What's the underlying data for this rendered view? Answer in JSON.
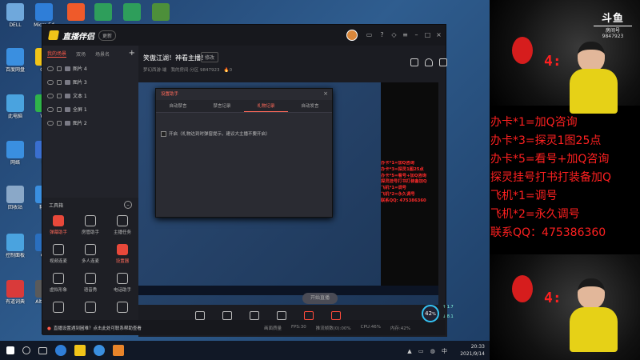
{
  "desktop": {
    "icons": [
      {
        "label": "DELL",
        "color": "#6fa8dc"
      },
      {
        "label": "Micro Ed",
        "color": "#2f7ed8"
      },
      {
        "label": "",
        "color": "#ef5a2a"
      },
      {
        "label": "",
        "color": "#2e9e5b"
      },
      {
        "label": "",
        "color": "#2e9e5b"
      },
      {
        "label": "",
        "color": "#4d8f3a"
      },
      {
        "label": "百度网盘",
        "color": "#3a8fe0"
      },
      {
        "label": "QQ",
        "color": "#f0c419"
      },
      {
        "label": "此电脑",
        "color": "#4aa3df"
      },
      {
        "label": "We",
        "color": "#2fb34a"
      },
      {
        "label": "网络",
        "color": "#3a8fe0"
      },
      {
        "label": "电",
        "color": "#3a6fd0"
      },
      {
        "label": "回收站",
        "color": "#8aa8c8"
      },
      {
        "label": "软件",
        "color": "#3a8fe0"
      },
      {
        "label": "控制面板",
        "color": "#4aa3df"
      },
      {
        "label": "Ge",
        "color": "#2a6fbf"
      },
      {
        "label": "有道词典",
        "color": "#d93a3a"
      },
      {
        "label": "Alt Des",
        "color": "#5a5a5a"
      }
    ]
  },
  "app": {
    "title": "直播伴侣",
    "version": "更新",
    "scene_tabs": [
      "我的场景",
      "双场",
      "场景名"
    ],
    "sources": [
      "图片 4",
      "图片 3",
      "文本 1",
      "全屏 1",
      "图片 2"
    ],
    "tools_title": "工具箱",
    "tools": [
      {
        "label": "弹幕助手",
        "active": true
      },
      {
        "label": "房管助手",
        "active": false
      },
      {
        "label": "主播任务",
        "active": false
      },
      {
        "label": "视频连麦",
        "active": false
      },
      {
        "label": "多人连麦",
        "active": false
      },
      {
        "label": "设置器",
        "active": true
      },
      {
        "label": "虚拟形象",
        "active": false
      },
      {
        "label": "语音秀",
        "active": false
      },
      {
        "label": "电话助手",
        "active": false
      },
      {
        "label": "",
        "active": false
      },
      {
        "label": "",
        "active": false
      },
      {
        "label": "",
        "active": false
      }
    ],
    "room_title": "笑傲江湖！神看主播！",
    "room_edit": "修改",
    "room_sub_category": "梦幻西游·端",
    "room_sub_info": "我的房间·分区 9847923",
    "room_sub_count": "0",
    "dialog": {
      "title": "设置助手",
      "tabs": [
        "自动禁言",
        "禁言记录",
        "礼物记录",
        "自动发言"
      ],
      "active_tab": 2,
      "option": "开启（礼物达到时弹窗提示，建议大主播不要开启）"
    },
    "inner_stream_text": [
      "办卡*1=加Q咨询",
      "办卡*3=探灵1图25点",
      "办卡*5=看号+加Q咨询",
      "探灵挂号打书打装备加Q",
      "飞机*1=调号",
      "飞机*2=永久调号",
      "联系QQ: 475386360"
    ],
    "controls": [
      {
        "label": "直播屏幕"
      },
      {
        "label": "摄像头"
      },
      {
        "label": "手机投屏"
      },
      {
        "label": "多媒体"
      },
      {
        "label": "麦克风"
      },
      {
        "label": "扬声器"
      }
    ],
    "live_button": "开始直播",
    "gauge_value": "42",
    "gauge_unit": "%",
    "speed_up": "1.7",
    "speed_down": "8.1",
    "status_msg": "直播设置遇到困难？点击此处可联系帮助查看",
    "status_metrics": [
      "画面质量",
      "FPS:30",
      "推流帧数(0):00%",
      "CPU:46%",
      "内存:42%"
    ]
  },
  "overlay": {
    "logo_mark": "斗鱼",
    "logo_sub": "房间号",
    "room_id": "9847923",
    "score": "4:",
    "promo_lines": [
      "办卡*1=加Q咨询",
      "办卡*3=探灵1图25点",
      "办卡*5=看号+加Q咨询",
      "探灵挂号打书打装备加Q",
      "飞机*1=调号",
      "飞机*2=永久调号",
      "联系QQ：475386360"
    ]
  },
  "taskbar": {
    "time": "20:33",
    "date": "2021/9/14",
    "tray_lang": "中"
  }
}
